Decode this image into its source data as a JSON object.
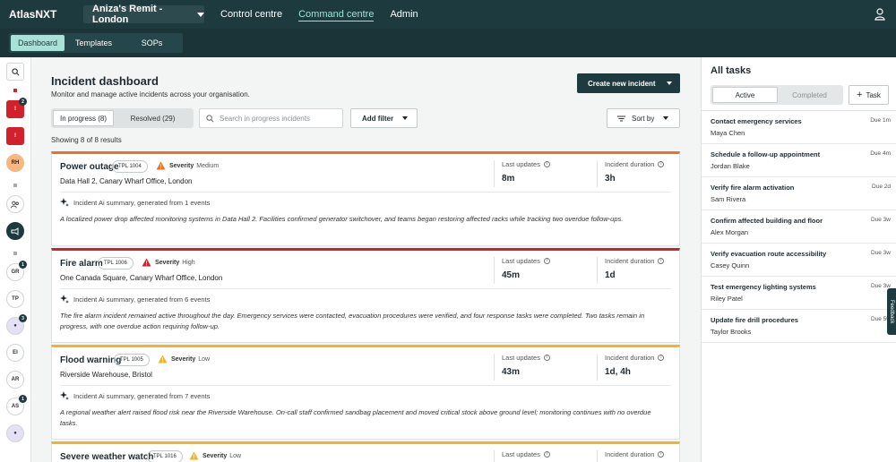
{
  "app": {
    "brand": "AtlasNXT",
    "org_selector": "Aniza's Remit - London",
    "nav": [
      "Control centre",
      "Command centre",
      "Admin"
    ],
    "active_nav": "Command centre"
  },
  "subnav": {
    "tabs": [
      "Dashboard",
      "Templates",
      "SOPs"
    ],
    "active": "Dashboard"
  },
  "rail": {
    "avatars": [
      "RH",
      "GR",
      "TP",
      "EI",
      "AR",
      "AS"
    ],
    "badges": [
      "2",
      "1",
      "3",
      "1"
    ],
    "alert_label": "!"
  },
  "main": {
    "title": "Incident dashboard",
    "subtitle": "Monitor and manage active incidents across your organisation.",
    "create_button": "Create new incident",
    "status_tabs": {
      "in_progress": "In progress (8)",
      "resolved": "Resolved (29)"
    },
    "search_placeholder": "Search in progress incidents",
    "filter_button": "Add filter",
    "sort_button": "Sort by",
    "results_text": "Showing 8 of 8 results"
  },
  "labels": {
    "severity": "Severity",
    "last_updates": "Last updates",
    "incident_duration": "Incident duration"
  },
  "incidents": [
    {
      "title": "Power outage",
      "tpl": "TPL 1004",
      "severity": "Medium",
      "severity_color": "#e8742a",
      "location": "Data Hall 2, Canary Wharf Office, London",
      "last_updates": "8m",
      "duration": "3h",
      "ai_line": "Incident Ai summary, generated from 1 events",
      "summary": "A localized power drop affected monitoring systems in Data Hall 2. Facilities confirmed generator switchover, and teams began restoring affected racks while tracking two overdue follow-ups."
    },
    {
      "title": "Fire alarm",
      "tpl": "TPL 1006",
      "severity": "High",
      "severity_color": "#d2212a",
      "location": "One Canada Square, Canary Wharf Office, London",
      "last_updates": "45m",
      "duration": "1d",
      "ai_line": "Incident Ai summary, generated from 6 events",
      "summary": "The fire alarm incident remained active throughout the day. Emergency services were contacted, evacuation procedures were verified, and four response tasks were completed. Two tasks remain in progress, with one overdue action requiring follow-up."
    },
    {
      "title": "Flood warning",
      "tpl": "TPL 1005",
      "severity": "Low",
      "severity_color": "#f0b429",
      "location": "Riverside Warehouse, Bristol",
      "last_updates": "43m",
      "duration": "1d, 4h",
      "ai_line": "Incident Ai summary, generated from 7 events",
      "summary": "A regional weather alert raised flood risk near the Riverside Warehouse. On-call staff confirmed sandbag placement and moved critical stock above ground level; monitoring continues with no overdue tasks."
    },
    {
      "title": "Severe weather watch",
      "tpl": "TPL 1016",
      "severity": "Low",
      "severity_color": "#f0b429"
    }
  ],
  "tasks_panel": {
    "title": "All tasks",
    "tabs": [
      "Active",
      "Completed"
    ],
    "active_tab": "Active",
    "add_button": "Task",
    "feedback_label": "Feedback",
    "tasks": [
      {
        "title": "Contact emergency services",
        "assignee": "Maya Chen",
        "due": "Due 1m"
      },
      {
        "title": "Schedule a follow-up appointment",
        "assignee": "Jordan Blake",
        "due": "Due 4m"
      },
      {
        "title": "Verify fire alarm activation",
        "assignee": "Sam Rivera",
        "due": "Due 2d"
      },
      {
        "title": "Confirm affected building and floor",
        "assignee": "Alex Morgan",
        "due": "Due 3w"
      },
      {
        "title": "Verify evacuation route accessibility",
        "assignee": "Casey Quinn",
        "due": "Due 3w"
      },
      {
        "title": "Test emergency lighting systems",
        "assignee": "Riley Patel",
        "due": "Due 3w"
      },
      {
        "title": "Update fire drill procedures",
        "assignee": "Taylor Brooks",
        "due": "Due 5w"
      }
    ]
  }
}
